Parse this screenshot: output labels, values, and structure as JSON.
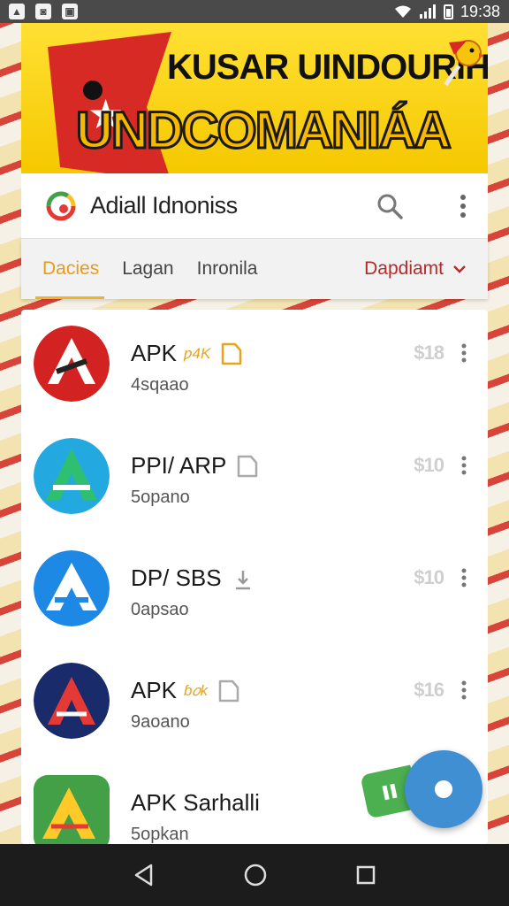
{
  "status_bar": {
    "time": "19:38",
    "left_icons": [
      "image-icon",
      "photo-icon",
      "gallery-icon"
    ],
    "right_icons": [
      "wifi-icon",
      "signal-icon",
      "battery-icon"
    ]
  },
  "banner": {
    "line1": "KUSAR UINDOURIH",
    "line2": "UNDCOMANIÁA"
  },
  "app_bar": {
    "title": "Adiall Idnoniss",
    "icons": [
      "search-icon",
      "more-vertical-icon"
    ]
  },
  "tabs": [
    {
      "label": "Dacies",
      "active": true
    },
    {
      "label": "Lagan",
      "active": false
    },
    {
      "label": "Inronila",
      "active": false
    }
  ],
  "dropdown": {
    "label": "Dapdiamt"
  },
  "apps": [
    {
      "name": "APK",
      "tag": "ƿ4K",
      "sub": "4sqaao",
      "price": "$18",
      "icon": "red-app-icon",
      "badge_color": "#e6a51c"
    },
    {
      "name": "PPI/ ARP",
      "tag": "",
      "sub": "5opano",
      "price": "$10",
      "icon": "teal-app-icon",
      "badge_color": "#aaaaaa"
    },
    {
      "name": "DP/  SBS",
      "tag": "",
      "sub": "0apsao",
      "price": "$10",
      "icon": "blue-app-icon",
      "badge_color": "#999999"
    },
    {
      "name": "APK",
      "tag": "ɓ𝑜k",
      "sub": "9aoano",
      "price": "$16",
      "icon": "navy-app-icon",
      "badge_color": "#aaaaaa"
    },
    {
      "name": "APK Sarhalli",
      "tag": "",
      "sub": "5opkan",
      "price": "",
      "icon": "green-app-icon",
      "badge_color": ""
    }
  ],
  "colors": {
    "accent": "#f0b429",
    "dropdown": "#b52a2a",
    "fab": "#3f8fd2"
  }
}
